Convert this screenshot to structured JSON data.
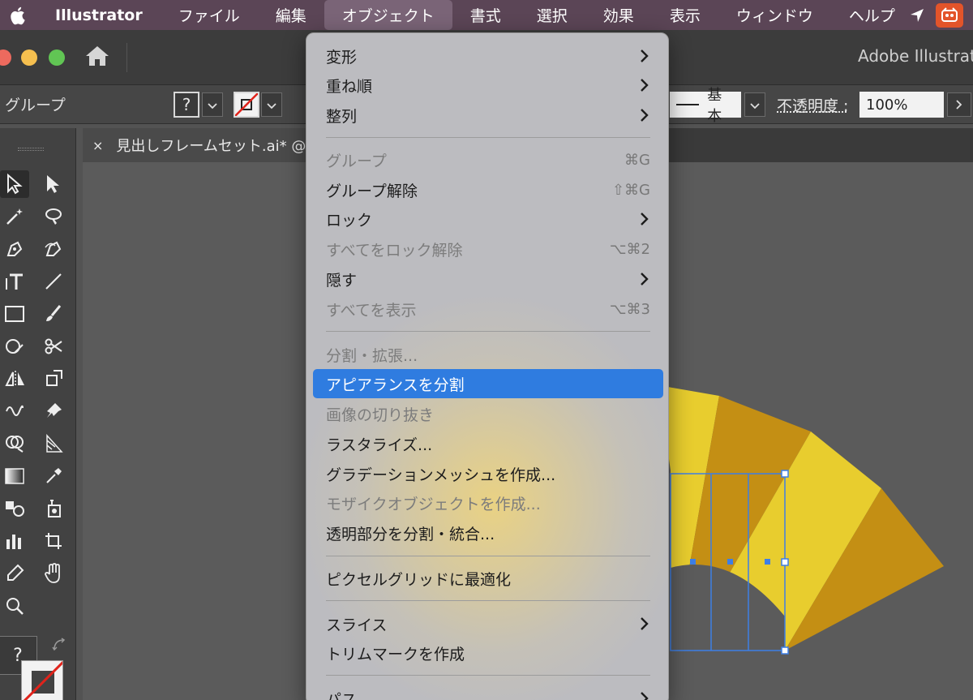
{
  "menubar": {
    "app_name": "Illustrator",
    "items": [
      "ファイル",
      "編集",
      "オブジェクト",
      "書式",
      "選択",
      "効果",
      "表示",
      "ウィンドウ",
      "ヘルプ"
    ],
    "active_index": 2,
    "bg_color": "#5b4556"
  },
  "window": {
    "app_title": "Adobe Illustrat"
  },
  "control_bar": {
    "selection_type": "グループ",
    "fill_swatch_label": "?",
    "stroke_profile": "基本",
    "opacity_label": "不透明度 :",
    "opacity_value": "100%"
  },
  "document_tab": {
    "close_label": "×",
    "title": "見出しフレームセット.ai* @"
  },
  "toolbar": {
    "fill_label": "?"
  },
  "object_menu": {
    "items": [
      {
        "label": "変形",
        "submenu": true
      },
      {
        "label": "重ね順",
        "submenu": true
      },
      {
        "label": "整列",
        "submenu": true
      },
      {
        "label": "グループ",
        "shortcut": "⌘G",
        "disabled": true
      },
      {
        "label": "グループ解除",
        "shortcut": "⇧⌘G"
      },
      {
        "label": "ロック",
        "submenu": true
      },
      {
        "label": "すべてをロック解除",
        "shortcut": "⌥⌘2",
        "disabled": true
      },
      {
        "label": "隠す",
        "submenu": true
      },
      {
        "label": "すべてを表示",
        "shortcut": "⌥⌘3",
        "disabled": true
      },
      {
        "label": "分割・拡張...",
        "disabled": true
      },
      {
        "label": "アピアランスを分割",
        "highlighted": true
      },
      {
        "label": "画像の切り抜き",
        "disabled": true
      },
      {
        "label": "ラスタライズ..."
      },
      {
        "label": "グラデーションメッシュを作成..."
      },
      {
        "label": "モザイクオブジェクトを作成...",
        "disabled": true
      },
      {
        "label": "透明部分を分割・統合..."
      },
      {
        "label": "ピクセルグリッドに最適化"
      },
      {
        "label": "スライス",
        "submenu": true
      },
      {
        "label": "トリムマークを作成"
      },
      {
        "label": "パス",
        "submenu": true
      }
    ]
  },
  "colors": {
    "highlight": "#2f7ce0",
    "fan_light": "#e8cd2e",
    "fan_dark": "#c48f14",
    "selection": "#3d7fe6"
  }
}
